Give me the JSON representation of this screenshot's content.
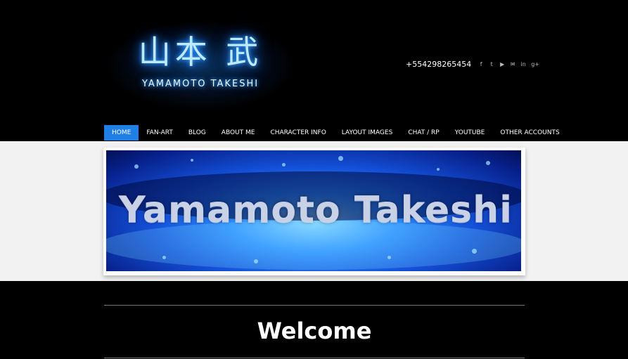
{
  "header": {
    "logo_kanji": "山本 武",
    "logo_latin": "YAMAMOTO TAKESHI",
    "phone": "+554298265454",
    "social_icons": [
      {
        "name": "facebook-icon",
        "glyph": "f"
      },
      {
        "name": "twitter-icon",
        "glyph": "t"
      },
      {
        "name": "youtube-icon",
        "glyph": "▶"
      },
      {
        "name": "email-icon",
        "glyph": "✉"
      },
      {
        "name": "linkedin-icon",
        "glyph": "in"
      },
      {
        "name": "googleplus-icon",
        "glyph": "g+"
      }
    ]
  },
  "nav": {
    "items": [
      {
        "label": "HOME",
        "active": true
      },
      {
        "label": "FAN-ART"
      },
      {
        "label": "BLOG"
      },
      {
        "label": "ABOUT ME"
      },
      {
        "label": "CHARACTER INFO"
      },
      {
        "label": "LAYOUT IMAGES"
      },
      {
        "label": "CHAT / RP"
      },
      {
        "label": "YOUTUBE"
      },
      {
        "label": "OTHER ACCOUNTS"
      }
    ]
  },
  "banner": {
    "title": "Yamamoto Takeshi"
  },
  "main": {
    "heading": "Welcome"
  },
  "colors": {
    "accent": "#1f7fe5",
    "background": "#000000",
    "banner_section": "#f2f2f2"
  }
}
